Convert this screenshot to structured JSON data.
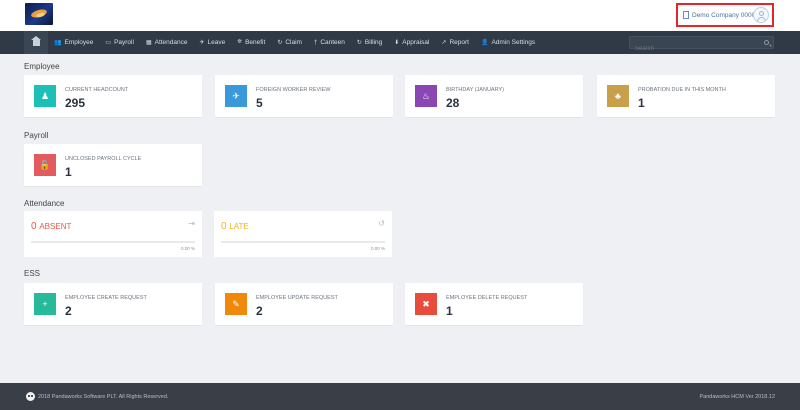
{
  "header": {
    "company": "Demo Company 00001"
  },
  "nav": {
    "search_placeholder": "Search",
    "items": [
      {
        "icon": "users-icon",
        "glyph": "👥",
        "label": "Employee"
      },
      {
        "icon": "money-icon",
        "glyph": "▭",
        "label": "Payroll"
      },
      {
        "icon": "calendar-icon",
        "glyph": "▦",
        "label": "Attendance"
      },
      {
        "icon": "plane-icon",
        "glyph": "✈",
        "label": "Leave"
      },
      {
        "icon": "gift-icon",
        "glyph": "⛯",
        "label": "Benefit"
      },
      {
        "icon": "claim-icon",
        "glyph": "↻",
        "label": "Claim"
      },
      {
        "icon": "canteen-icon",
        "glyph": "†",
        "label": "Canteen"
      },
      {
        "icon": "billing-icon",
        "glyph": "↻",
        "label": "Billing"
      },
      {
        "icon": "appraisal-icon",
        "glyph": "⬇",
        "label": "Appraisal"
      },
      {
        "icon": "report-icon",
        "glyph": "↗",
        "label": "Report"
      },
      {
        "icon": "admin-icon",
        "glyph": "👤",
        "label": "Admin Settings"
      }
    ]
  },
  "sections": {
    "employee": "Employee",
    "payroll": "Payroll",
    "attendance": "Attendance",
    "ess": "ESS"
  },
  "employee_cards": [
    {
      "label": "CURRENT HEADCOUNT",
      "value": "295",
      "color": "#1cc0b6",
      "icon": "person-icon",
      "glyph": "♟"
    },
    {
      "label": "FOREIGN WORKER REVIEW",
      "value": "5",
      "color": "#3a9ad9",
      "icon": "plane-icon",
      "glyph": "✈"
    },
    {
      "label": "BIRTHDAY (JANUARY)",
      "value": "28",
      "color": "#8a46b3",
      "icon": "cake-icon",
      "glyph": "♨"
    },
    {
      "label": "PROBATION DUE IN THIS MONTH",
      "value": "1",
      "color": "#c9a04a",
      "icon": "group-icon",
      "glyph": "♣"
    }
  ],
  "payroll_cards": [
    {
      "label": "UNCLOSED PAYROLL CYCLE",
      "value": "1",
      "color": "#e35a5f",
      "icon": "lock-icon",
      "glyph": "🔓"
    }
  ],
  "attendance": {
    "absent": {
      "count": "0",
      "label": "ABSENT",
      "pct_text": "0.00 %",
      "pct": 0,
      "color": "#e55a4c"
    },
    "late": {
      "count": "0",
      "label": "LATE",
      "pct_text": "0.00 %",
      "pct": 0,
      "color": "#f0b323"
    }
  },
  "ess_cards": [
    {
      "label": "EMPLOYEE CREATE REQUEST",
      "value": "2",
      "color": "#26b99a",
      "icon": "plus-icon",
      "glyph": "+"
    },
    {
      "label": "EMPLOYEE UPDATE REQUEST",
      "value": "2",
      "color": "#f0880a",
      "icon": "pencil-icon",
      "glyph": "✎"
    },
    {
      "label": "EMPLOYEE DELETE REQUEST",
      "value": "1",
      "color": "#e84c3d",
      "icon": "close-icon",
      "glyph": "✖"
    }
  ],
  "footer": {
    "copyright": "2018 Pandaworks Software PLT. All Rights Reserved.",
    "version": "Pandaworks HCM Ver 2018.12"
  }
}
